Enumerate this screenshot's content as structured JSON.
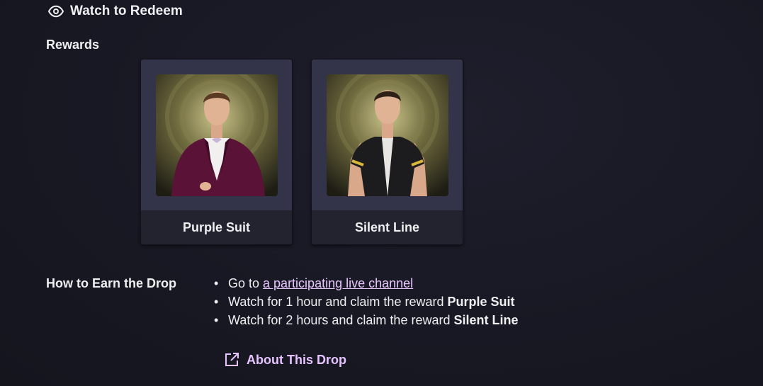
{
  "header": {
    "watch_label": "Watch to Redeem",
    "watch_icon": "eye-icon"
  },
  "rewards": {
    "title": "Rewards",
    "items": [
      {
        "name": "Purple Suit",
        "image": "character in purple tuxedo"
      },
      {
        "name": "Silent Line",
        "image": "character in black shirt with gold stripes"
      }
    ]
  },
  "how_to": {
    "title": "How to Earn the Drop",
    "steps": [
      {
        "prefix": "Go to ",
        "link": "a participating live channel",
        "bold": ""
      },
      {
        "prefix": "Watch for 1 hour and claim the reward ",
        "link": "",
        "bold": "Purple Suit"
      },
      {
        "prefix": "Watch for 2 hours and claim the reward ",
        "link": "",
        "bold": "Silent Line"
      }
    ],
    "bullet": "•"
  },
  "about_link": {
    "label": "About This Drop",
    "icon": "external-link-icon"
  },
  "colors": {
    "background": "#171722",
    "card": "#2a2a3b",
    "link": "#e8c8ff",
    "text": "#efeff1"
  }
}
